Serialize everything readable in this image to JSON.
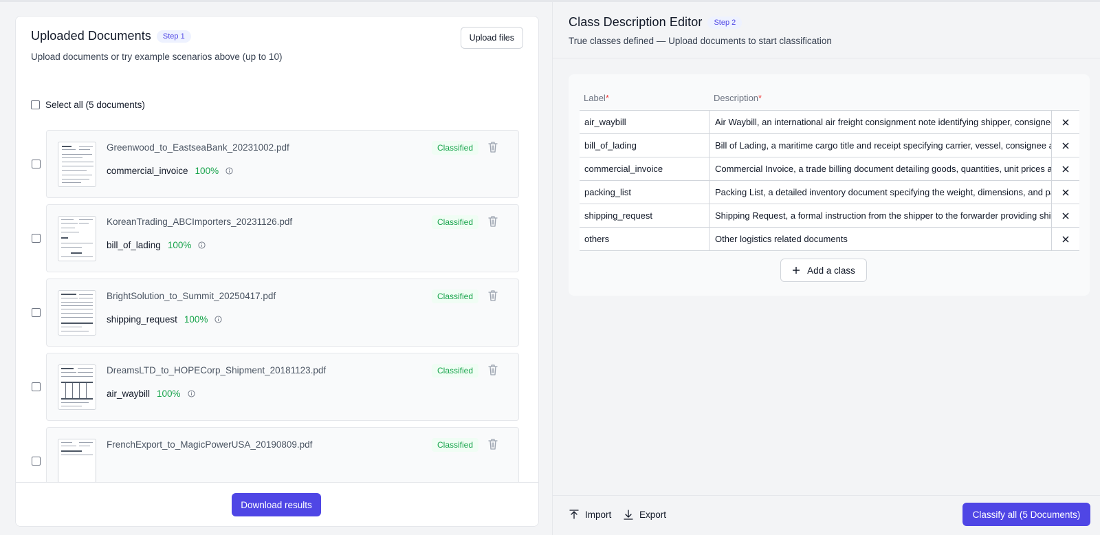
{
  "left": {
    "title": "Uploaded Documents",
    "step": "Step 1",
    "subtitle": "Upload documents or try example scenarios above (up to 10)",
    "upload_label": "Upload files",
    "select_all_label": "Select all (5 documents)",
    "documents": [
      {
        "filename": "Greenwood_to_EastseaBank_20231002.pdf",
        "status": "Classified",
        "class": "commercial_invoice",
        "confidence": "100%"
      },
      {
        "filename": "KoreanTrading_ABCImporters_20231126.pdf",
        "status": "Classified",
        "class": "bill_of_lading",
        "confidence": "100%"
      },
      {
        "filename": "BrightSolution_to_Summit_20250417.pdf",
        "status": "Classified",
        "class": "shipping_request",
        "confidence": "100%"
      },
      {
        "filename": "DreamsLTD_to_HOPECorp_Shipment_20181123.pdf",
        "status": "Classified",
        "class": "air_waybill",
        "confidence": "100%"
      },
      {
        "filename": "FrenchExport_to_MagicPowerUSA_20190809.pdf",
        "status": "Classified",
        "class": "",
        "confidence": ""
      }
    ],
    "download_label": "Download results"
  },
  "right": {
    "title": "Class Description Editor",
    "step": "Step 2",
    "subtitle": "True classes defined — Upload documents to start classification",
    "label_header": "Label",
    "desc_header": "Description",
    "required_mark": "*",
    "classes": [
      {
        "label": "air_waybill",
        "description": "Air Waybill, an international air freight consignment note identifying shipper, consignee and goods"
      },
      {
        "label": "bill_of_lading",
        "description": "Bill of Lading, a maritime cargo title and receipt specifying carrier, vessel, consignee and goods"
      },
      {
        "label": "commercial_invoice",
        "description": "Commercial Invoice, a trade billing document detailing goods, quantities, unit prices and totals"
      },
      {
        "label": "packing_list",
        "description": "Packing List, a detailed inventory document specifying the weight, dimensions, and packaging of goods"
      },
      {
        "label": "shipping_request",
        "description": "Shipping Request, a formal instruction from the shipper to the forwarder providing shipment details"
      },
      {
        "label": "others",
        "description": "Other logistics related documents"
      }
    ],
    "add_class_label": "Add a class",
    "import_label": "Import",
    "export_label": "Export",
    "classify_label": "Classify all (5 Documents)"
  },
  "colors": {
    "accent": "#4f46e5",
    "success": "#16a34a",
    "required": "#ef4444"
  }
}
